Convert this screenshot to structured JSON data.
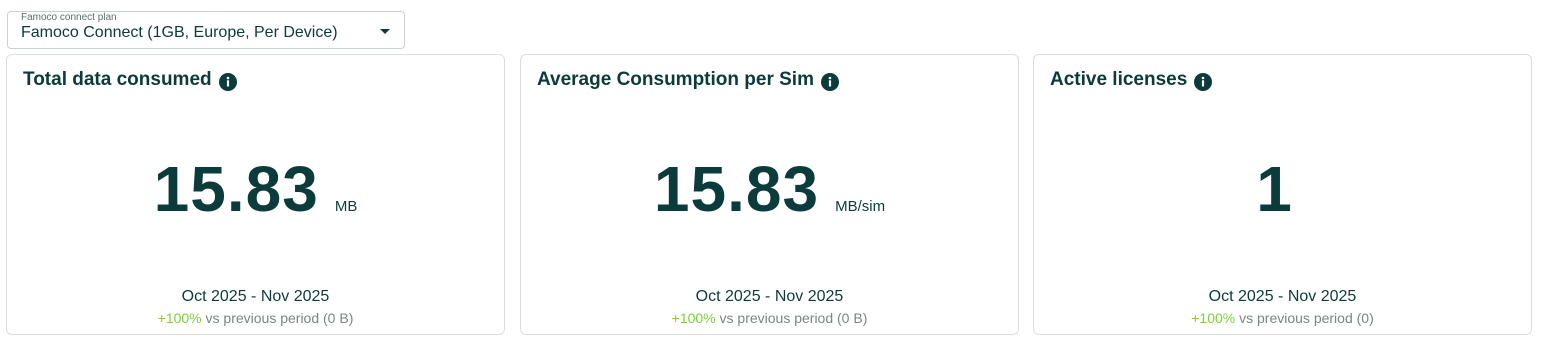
{
  "plan_select": {
    "label": "Famoco connect plan",
    "value": "Famoco Connect (1GB, Europe, Per Device)"
  },
  "cards": [
    {
      "title": "Total data consumed",
      "value": "15.83",
      "unit": "MB",
      "period": "Oct 2025 - Nov 2025",
      "delta": "+100%",
      "comparison": "vs previous period (0 B)"
    },
    {
      "title": "Average Consumption per Sim",
      "value": "15.83",
      "unit": "MB/sim",
      "period": "Oct 2025 - Nov 2025",
      "delta": "+100%",
      "comparison": "vs previous period (0 B)"
    },
    {
      "title": "Active licenses",
      "value": "1",
      "unit": "",
      "period": "Oct 2025 - Nov 2025",
      "delta": "+100%",
      "comparison": "vs previous period (0)"
    }
  ],
  "colors": {
    "text_primary": "#0b3b3a",
    "positive_delta": "#7ccf3c",
    "muted": "#7b8584",
    "border": "#d9dfdf"
  },
  "icons": {
    "info": "info-icon",
    "dropdown": "chevron-down-icon"
  }
}
